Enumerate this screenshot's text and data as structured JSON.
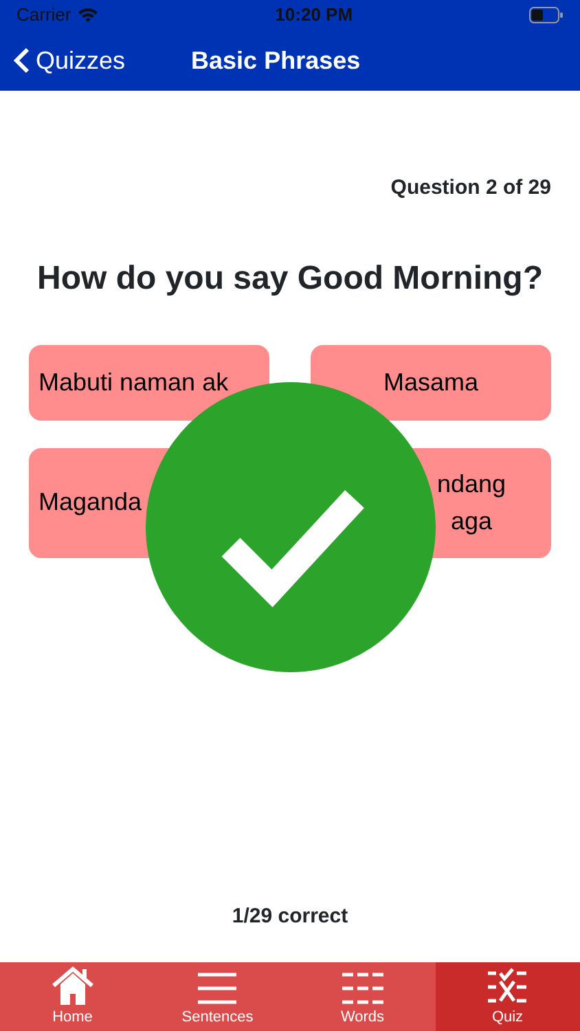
{
  "status_bar": {
    "carrier": "Carrier",
    "time": "10:20 PM"
  },
  "nav": {
    "back": "Quizzes",
    "title": "Basic Phrases"
  },
  "progress": "Question 2 of 29",
  "question": "How do you say Good Morning?",
  "answers": [
    {
      "text": "Mabuti naman ak"
    },
    {
      "text": "Masama"
    },
    {
      "text": "Maganda"
    },
    {
      "text": "ndang\naga"
    }
  ],
  "result": {
    "kind": "correct"
  },
  "score": "1/29 correct",
  "tabs": [
    {
      "label": "Home",
      "selected": false
    },
    {
      "label": "Sentences",
      "selected": false
    },
    {
      "label": "Words",
      "selected": false
    },
    {
      "label": "Quiz",
      "selected": true
    }
  ]
}
